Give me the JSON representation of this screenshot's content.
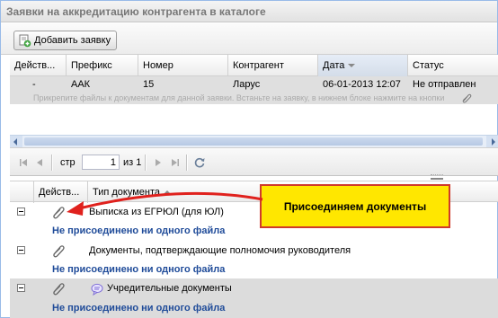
{
  "panel": {
    "title": "Заявки на аккредитацию контрагента в каталоге"
  },
  "toolbar": {
    "add_label": "Добавить заявку",
    "add_icon": "add-document-icon"
  },
  "requests_grid": {
    "columns": [
      "Действ...",
      "Префикс",
      "Номер",
      "Контрагент",
      "Дата",
      "Статус"
    ],
    "rows": [
      {
        "action": "-",
        "prefix": "ААК",
        "number": "15",
        "counterparty": "Ларус",
        "date": "06-01-2013 12:07",
        "status": "Не отправлен"
      }
    ],
    "hint": "Прикрепите файлы к документам для данной заявки. Встаньте на заявку, в нижнем блоке нажмите на кнопки"
  },
  "pager": {
    "page_label": "стр",
    "page_value": "1",
    "of_label": "из 1"
  },
  "docs_grid": {
    "columns": [
      "Действ...",
      "Тип документа"
    ],
    "rows": [
      {
        "name": "Выписка из ЕГРЮЛ (для ЮЛ)",
        "files": "Не присоединено ни одного файла"
      },
      {
        "name": "Документы, подтверждающие полномочия руководителя",
        "files": "Не присоединено ни одного файла"
      },
      {
        "name": "Учредительные документы",
        "files": "Не присоединено ни одного файла"
      }
    ]
  },
  "callout": {
    "text": "Присоединяем документы"
  },
  "colors": {
    "header_bg": "#ececec",
    "selected_row": "#dfdfdf",
    "link_blue": "#1f4b99",
    "callout_bg": "#ffe700",
    "callout_border": "#d03a2a"
  }
}
